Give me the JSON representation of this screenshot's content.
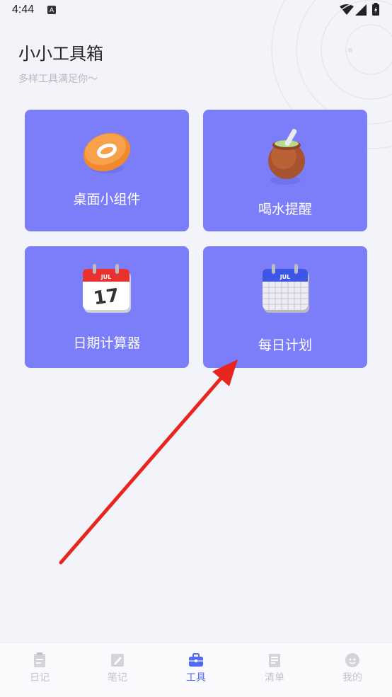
{
  "status": {
    "time": "4:44",
    "notif_icon": "A"
  },
  "header": {
    "title": "小小工具箱",
    "subtitle": "多样工具满足你～"
  },
  "tools": [
    {
      "label": "桌面小组件",
      "icon": "widget-disc-icon"
    },
    {
      "label": "喝水提醒",
      "icon": "water-cup-icon"
    },
    {
      "label": "日期计算器",
      "icon": "calendar-date-icon",
      "date_month": "JUL",
      "date_day": "17"
    },
    {
      "label": "每日计划",
      "icon": "calendar-plan-icon",
      "date_month": "JUL"
    }
  ],
  "tabs": [
    {
      "label": "日记",
      "icon": "diary-icon",
      "active": false
    },
    {
      "label": "笔记",
      "icon": "note-icon",
      "active": false
    },
    {
      "label": "工具",
      "icon": "toolbox-icon",
      "active": true
    },
    {
      "label": "清单",
      "icon": "list-icon",
      "active": false
    },
    {
      "label": "我的",
      "icon": "profile-icon",
      "active": false
    }
  ],
  "colors": {
    "card": "#7b7ef8",
    "accent": "#4f6bf1",
    "arrow": "#e8251f"
  }
}
